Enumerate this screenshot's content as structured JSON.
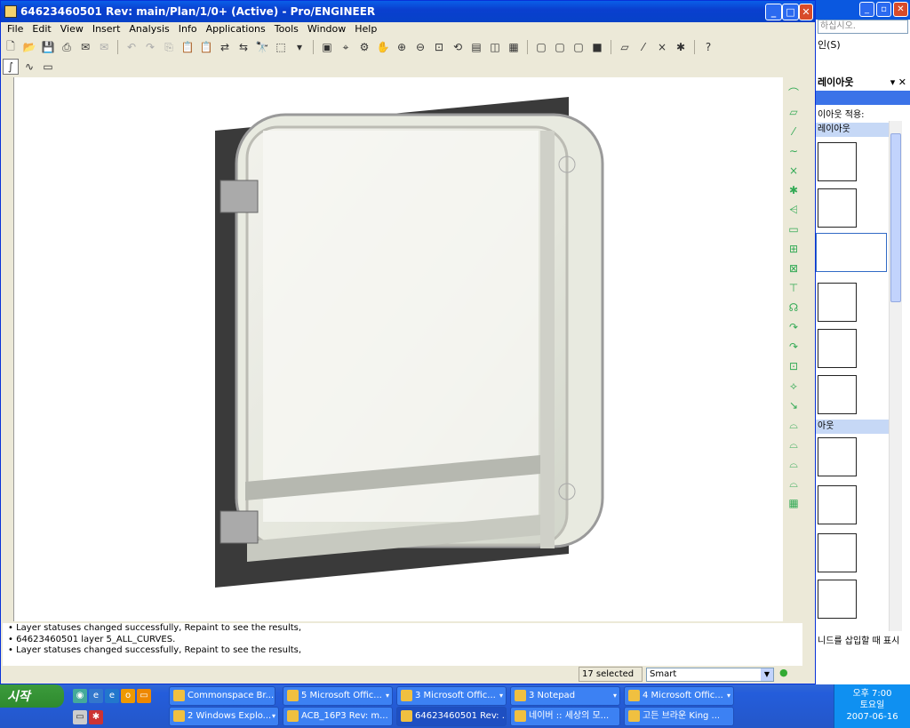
{
  "window": {
    "title": "64623460501 Rev: main/Plan/1/0+ (Active) - Pro/ENGINEER",
    "minimize": "_",
    "maximize": "□",
    "close": "✕"
  },
  "menu": [
    "File",
    "Edit",
    "View",
    "Insert",
    "Analysis",
    "Info",
    "Applications",
    "Tools",
    "Window",
    "Help"
  ],
  "messages": [
    "• Layer statuses changed successfully, Repaint to see the results,",
    "• 64623460501 layer 5_ALL_CURVES.",
    "• Layer statuses changed successfully, Repaint to see the results,"
  ],
  "status": {
    "selected": "17 selected",
    "filter": "Smart"
  },
  "word_pane": {
    "search_placeholder": "하십시오.",
    "search_label": "인(S)",
    "heading": "레이아웃",
    "apply_label": "이아웃 적용:",
    "section1": "레이아웃",
    "section2": "아웃",
    "footer": "니드를 삽입할 때 표시"
  },
  "taskbar": {
    "start": "시작",
    "row1": [
      {
        "label": "Commonspace Br..."
      },
      {
        "label": "5 Microsoft Offic..."
      },
      {
        "label": "3 Microsoft Offic..."
      },
      {
        "label": "3 Notepad"
      },
      {
        "label": "4 Microsoft Offic..."
      }
    ],
    "row2": [
      {
        "label": "2 Windows Explo..."
      },
      {
        "label": "ACB_16P3 Rev: m..."
      },
      {
        "label": "64623460501 Rev: ..."
      },
      {
        "label": "네이버 :: 세상의 모..."
      },
      {
        "label": "고든 브라운 King ..."
      }
    ],
    "clock": {
      "time": "오후 7:00",
      "day": "토요일",
      "date": "2007-06-16"
    }
  }
}
